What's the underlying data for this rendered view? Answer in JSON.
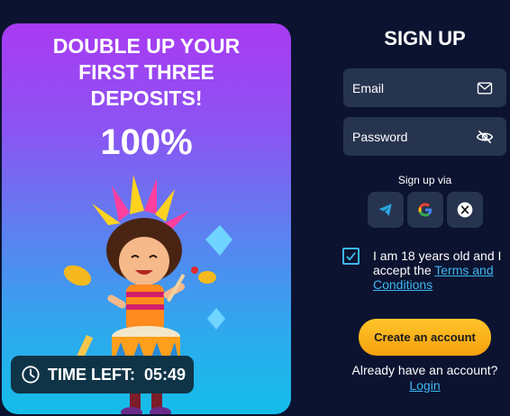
{
  "promo": {
    "title": "DOUBLE UP YOUR FIRST THREE DEPOSITS!",
    "percent": "100%",
    "timer_label": "TIME LEFT:",
    "timer_value": "05:49"
  },
  "signup": {
    "title": "SIGN UP",
    "email_placeholder": "Email",
    "password_placeholder": "Password",
    "via_label": "Sign up via",
    "social": [
      "telegram-icon",
      "google-icon",
      "x-icon"
    ],
    "agree_text": "I am 18 years old and I accept the ",
    "terms_link": "Terms and Conditions",
    "agree_checked": true,
    "create_button": "Create an account",
    "already_text": "Already have an account?",
    "login_link": "Login"
  },
  "colors": {
    "background": "#0b1330",
    "field": "#27344f",
    "accent_link": "#3fb6f0",
    "button": "#ffc52a"
  }
}
